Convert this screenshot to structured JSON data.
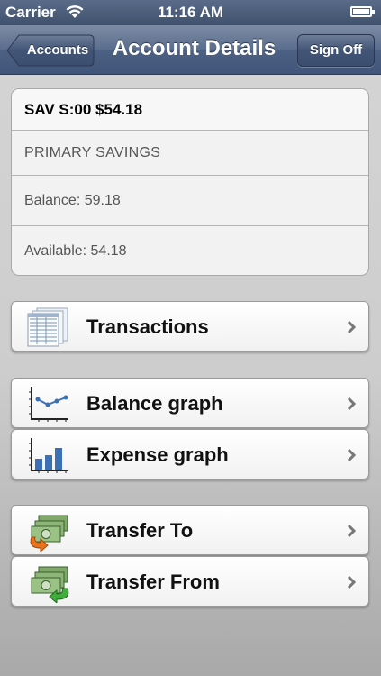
{
  "status_bar": {
    "carrier": "Carrier",
    "time": "11:16 AM"
  },
  "nav": {
    "back_label": "Accounts",
    "title": "Account Details",
    "signoff_label": "Sign Off"
  },
  "account": {
    "header": "SAV S:00 $54.18",
    "name": "PRIMARY SAVINGS",
    "balance": "Balance: 59.18",
    "available": "Available: 54.18"
  },
  "menu": {
    "transactions": {
      "label": "Transactions",
      "icon": "ledger-icon"
    },
    "balance_graph": {
      "label": "Balance graph",
      "icon": "line-chart-icon"
    },
    "expense_graph": {
      "label": "Expense graph",
      "icon": "bar-chart-icon"
    },
    "transfer_to": {
      "label": "Transfer To",
      "icon": "money-arrow-out-icon"
    },
    "transfer_from": {
      "label": "Transfer From",
      "icon": "money-arrow-in-icon"
    }
  },
  "colors": {
    "nav": "#4d6183",
    "page_bg": "#cdcdcd",
    "chevron": "#777777"
  }
}
